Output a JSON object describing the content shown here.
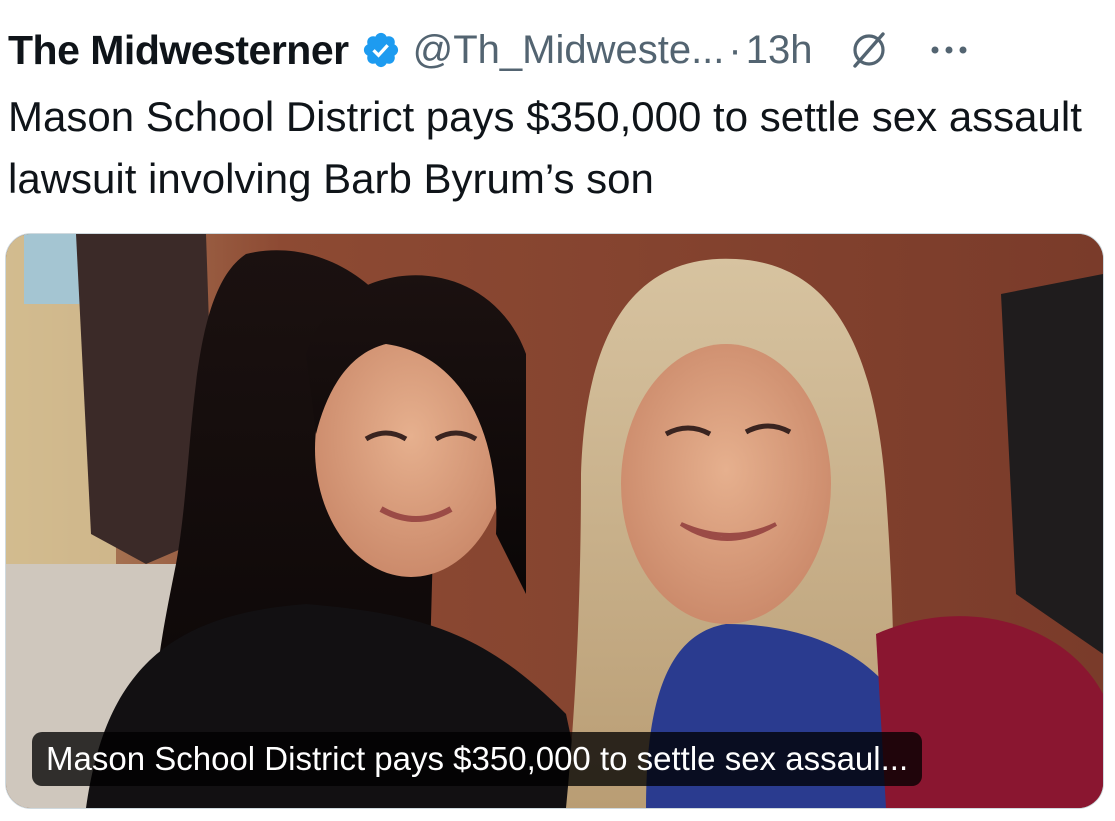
{
  "tweet": {
    "display_name": "The Midwesterner",
    "handle": "@Th_Midweste...",
    "separator": "·",
    "time": "13h",
    "text": "Mason School District pays $350,000 to settle sex assault lawsuit involving Barb Byrum’s son",
    "verified_icon": "verified-badge-icon",
    "grok_icon": "grok-icon",
    "more_icon": "more-options-icon"
  },
  "card": {
    "image_description_icon": "photo",
    "caption": "Mason School District pays $350,000 to settle sex assaul..."
  },
  "colors": {
    "text": "#0f1419",
    "secondary": "#536471",
    "verified": "#1d9bf0",
    "caption_bg": "#000000"
  }
}
